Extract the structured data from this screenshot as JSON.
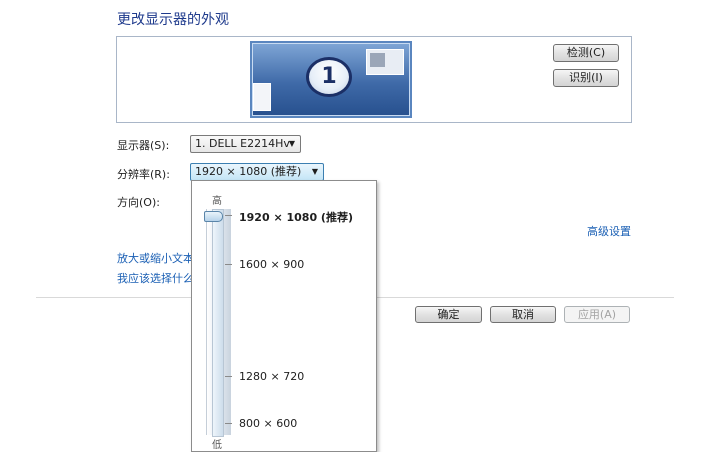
{
  "title": "更改显示器的外观",
  "preview": {
    "monitor_number": "1",
    "detect_label": "检测(C)",
    "identify_label": "识别(I)"
  },
  "display": {
    "label": "显示器(S):",
    "value": "1. DELL E2214Hv"
  },
  "resolution": {
    "label": "分辨率(R):",
    "value": "1920 × 1080 (推荐)",
    "options": [
      "1920 × 1080 (推荐)",
      "1600 × 900",
      "1280 × 720",
      "800 × 600"
    ],
    "selected_index": 0,
    "scale_high": "高",
    "scale_low": "低"
  },
  "orientation": {
    "label": "方向(O):"
  },
  "links": {
    "advanced": "高级设置",
    "text_size": "放大或缩小文本",
    "which_settings": "我应该选择什么"
  },
  "buttons": {
    "ok": "确定",
    "cancel": "取消",
    "apply": "应用(A)"
  },
  "colors": {
    "link": "#1a5fb4",
    "title": "#1e3a8c",
    "monitor": "#3f6aa8"
  }
}
